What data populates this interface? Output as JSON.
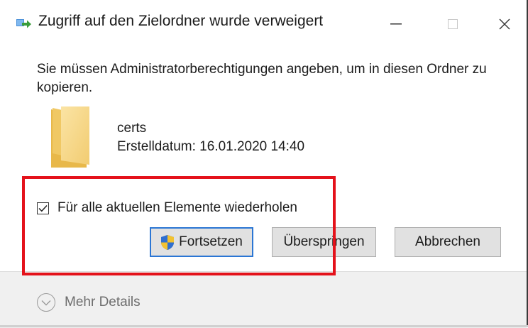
{
  "window": {
    "title": "Zugriff auf den Zielordner wurde verweigert",
    "controls": {
      "minimize": "—",
      "maximize": "☐",
      "close": "✕"
    }
  },
  "dialog": {
    "message": "Sie müssen Administratorberechtigungen angeben, um in diesen Ordner zu kopieren.",
    "item": {
      "icon": "folder-icon",
      "name": "certs",
      "created": "Erstelldatum: 16.01.2020 14:40"
    },
    "repeat_checkbox": {
      "label": "Für alle aktuellen Elemente wiederholen",
      "checked": true
    },
    "buttons": {
      "continue_label": "Fortsetzen",
      "continue_icon": "uac-shield-icon",
      "skip_label": "Überspringen",
      "cancel_label": "Abbrechen"
    }
  },
  "footer": {
    "details_label": "Mehr Details"
  },
  "colors": {
    "highlight": "#e4121b",
    "default_button_border": "#2b76d4",
    "folder": "#f5d175"
  }
}
